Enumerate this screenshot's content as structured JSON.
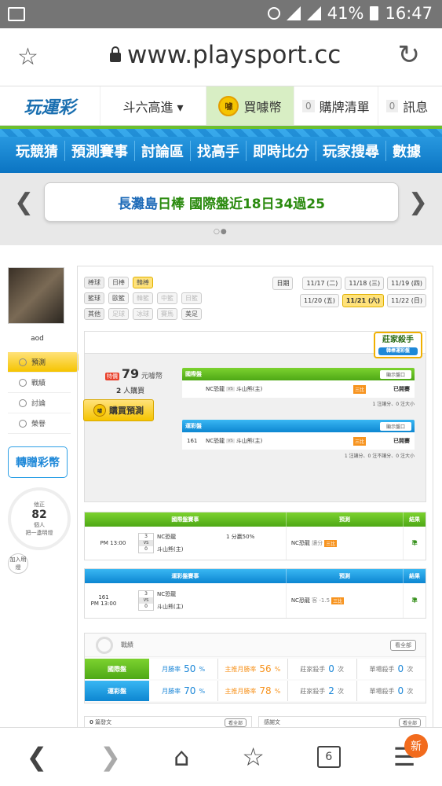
{
  "status": {
    "battery": "41%",
    "time": "16:47"
  },
  "browser": {
    "url": "www.playsport.cc"
  },
  "site": {
    "logo": "玩運彩"
  },
  "topnav": {
    "selector": "斗六高進 ▾",
    "buy_coin": "買噱幣",
    "coin_icon": "噱",
    "cart_count": "0",
    "cart": "購牌清單",
    "msg_count": "0",
    "msg": "訊息"
  },
  "menu": [
    "玩競猜",
    "預測賽事",
    "討論區",
    "找高手",
    "即時比分",
    "玩家搜尋",
    "數據"
  ],
  "banner": {
    "part1": "長灘島 ",
    "part2": "日棒 國際盤近18日34過25",
    "dots": "○●"
  },
  "sidebar": {
    "username": "aod",
    "items": [
      {
        "label": "預測"
      },
      {
        "label": "戰績"
      },
      {
        "label": "討論"
      },
      {
        "label": "榮譽"
      }
    ],
    "transfer": "轉贈彩幣",
    "stat_top": "他正",
    "stat_num": "82",
    "stat_unit": "個人",
    "stat_bottom": "把一盞明燈",
    "add": "加入明燈"
  },
  "filters": {
    "baseball_label": "棒球",
    "baseball": [
      "日棒",
      "韓棒"
    ],
    "basketball_label": "籃球",
    "basketball": [
      "歐籃",
      "韓籃",
      "中籃",
      "日籃"
    ],
    "other_label": "其他",
    "other": [
      "足球",
      "冰球",
      "賽馬",
      "美足"
    ]
  },
  "dates": {
    "label": "日期",
    "row1": [
      "11/17 (二)",
      "11/18 (三)",
      "11/19 (四)"
    ],
    "row2": [
      "11/20 (五)",
      "11/21 (六)",
      "11/22 (日)"
    ]
  },
  "prediction": {
    "killer_title": "莊家殺手",
    "killer_sub": "韓棒運彩盤",
    "special": "特價",
    "price": "79",
    "price_unit": "元噱幣",
    "buyers": "2",
    "buyers_unit": "人購買",
    "buy_button": "購買預測",
    "buy_coin": "噱",
    "intl": {
      "title": "國際盤",
      "btn": "顯示盤口",
      "num": "",
      "home": "NC恐龍",
      "vs": "VS",
      "away": "斗山熊(主)",
      "icon": "三比",
      "status": "已開賽",
      "note": "1 注讓分、0 注大小"
    },
    "lottery": {
      "title": "運彩盤",
      "btn": "顯示盤口",
      "num": "161",
      "home": "NC恐龍",
      "vs": "VS",
      "away": "斗山熊(主)",
      "icon": "三比",
      "status": "已開賽",
      "note": "1 注讓分、0 注不讓分、0 注大小"
    }
  },
  "table1": {
    "headers": [
      "國際盤賽事",
      "預測",
      "結果"
    ],
    "num": "",
    "time": "PM 13:00",
    "score_home": "3",
    "vs": "VS",
    "score_away": "0",
    "home": "NC恐龍",
    "away": "斗山熊(主)",
    "line": "1 分贏50%",
    "pick": "NC恐龍",
    "pick_type": "讓分",
    "tag": "三比",
    "result": "準"
  },
  "table2": {
    "headers": [
      "運彩盤賽事",
      "預測",
      "結果"
    ],
    "num": "161",
    "time": "PM 13:00",
    "score_home": "3",
    "vs": "VS",
    "score_away": "0",
    "home": "NC恐龍",
    "away": "斗山熊(主)",
    "line": "",
    "pick": "NC恐龍",
    "pick_type": "客 -1.5",
    "tag": "三比",
    "result": "準"
  },
  "record": {
    "title": "戰績",
    "see_all": "看全部",
    "intl": {
      "label": "國際盤",
      "monthly": "月勝率",
      "monthly_val": "50",
      "pct": "%",
      "main": "主推月勝率",
      "main_val": "56",
      "killer": "莊家殺手",
      "killer_val": "0",
      "killer_unit": "次",
      "single": "單場殺手",
      "single_val": "0",
      "single_unit": "次"
    },
    "lottery": {
      "label": "運彩盤",
      "monthly": "月勝率",
      "monthly_val": "70",
      "pct": "%",
      "main": "主推月勝率",
      "main_val": "78",
      "killer": "莊家殺手",
      "killer_val": "2",
      "killer_unit": "次",
      "single": "單場殺手",
      "single_val": "0",
      "single_unit": "次"
    }
  },
  "bottom": {
    "posts_count": "0",
    "posts": "篇發文",
    "see_all": "看全部",
    "thanks": "感謝文",
    "see_all2": "看全部"
  },
  "botnav": {
    "tabs_count": "6",
    "new_badge": "新"
  }
}
